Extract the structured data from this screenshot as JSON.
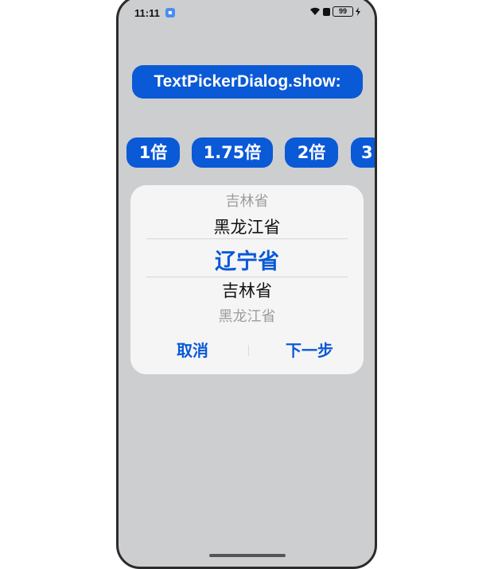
{
  "status_bar": {
    "time": "11:11",
    "battery": "99",
    "icons": [
      "app-notification-icon",
      "wifi-icon",
      "signal-icon",
      "battery-icon",
      "charging-icon"
    ]
  },
  "title_button": {
    "label": "TextPickerDialog.show:"
  },
  "speed_buttons": [
    {
      "label": "1倍"
    },
    {
      "label": "1.75倍"
    },
    {
      "label": "2倍"
    },
    {
      "label": "3"
    }
  ],
  "picker": {
    "items": [
      "吉林省",
      "黑龙江省",
      "辽宁省",
      "吉林省",
      "黑龙江省"
    ],
    "selected_index": 2
  },
  "dialog_actions": {
    "cancel_label": "取消",
    "next_label": "下一步"
  },
  "colors": {
    "accent": "#0a59d6",
    "background": "#cdcecf",
    "dialog": "#f5f5f6"
  }
}
